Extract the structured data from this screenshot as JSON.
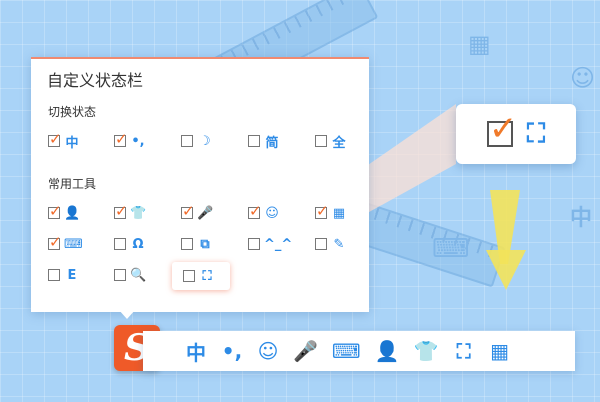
{
  "panel": {
    "title": "自定义状态栏",
    "switch_section": {
      "label": "切换状态",
      "items": [
        {
          "id": "zh",
          "checked": true,
          "icon": "中",
          "icon_name": "chinese-mode-icon"
        },
        {
          "id": "punct",
          "checked": true,
          "icon": "•,",
          "icon_name": "punctuation-icon"
        },
        {
          "id": "halfwidth",
          "checked": false,
          "icon": "☽",
          "icon_name": "moon-halfwidth-icon"
        },
        {
          "id": "simplified",
          "checked": false,
          "icon": "简",
          "icon_name": "simplified-chinese-icon"
        },
        {
          "id": "fullwidth",
          "checked": false,
          "icon": "全",
          "icon_name": "fullwidth-icon"
        }
      ]
    },
    "tools_section": {
      "label": "常用工具",
      "items": [
        {
          "id": "user",
          "checked": true,
          "icon": "👤",
          "icon_name": "user-icon"
        },
        {
          "id": "skin",
          "checked": true,
          "icon": "👕",
          "icon_name": "skin-shirt-icon"
        },
        {
          "id": "voice",
          "checked": true,
          "icon": "🎤",
          "icon_name": "microphone-icon"
        },
        {
          "id": "emoji",
          "checked": true,
          "icon": "☺",
          "icon_name": "emoji-icon"
        },
        {
          "id": "toolbox",
          "checked": true,
          "icon": "▦",
          "icon_name": "toolbox-grid-icon"
        },
        {
          "id": "keyboard",
          "checked": true,
          "icon": "⌨",
          "icon_name": "keyboard-icon"
        },
        {
          "id": "headset",
          "checked": false,
          "icon": "Ω",
          "icon_name": "headset-icon"
        },
        {
          "id": "window",
          "checked": false,
          "icon": "⧉",
          "icon_name": "window-icon"
        },
        {
          "id": "kaomoji",
          "checked": false,
          "icon": "^_^",
          "icon_name": "kaomoji-icon"
        },
        {
          "id": "pen",
          "checked": false,
          "icon": "✎",
          "icon_name": "pen-icon"
        },
        {
          "id": "translate",
          "checked": false,
          "icon": "E",
          "icon_name": "translate-icon"
        },
        {
          "id": "search",
          "checked": false,
          "icon": "🔍",
          "icon_name": "search-icon"
        },
        {
          "id": "crop",
          "checked": false,
          "icon": "⛶",
          "icon_name": "crop-icon"
        }
      ]
    }
  },
  "callout": {
    "checked": true,
    "icon": "⛶",
    "icon_name": "crop-icon"
  },
  "toolbar": {
    "logo": "S",
    "items": [
      {
        "icon": "中",
        "icon_name": "chinese-mode-icon"
      },
      {
        "icon": "•,",
        "icon_name": "punctuation-icon"
      },
      {
        "icon": "☺",
        "icon_name": "emoji-icon"
      },
      {
        "icon": "🎤",
        "icon_name": "microphone-icon"
      },
      {
        "icon": "⌨",
        "icon_name": "keyboard-icon"
      },
      {
        "icon": "👤",
        "icon_name": "user-card-icon"
      },
      {
        "icon": "👕",
        "icon_name": "skin-shirt-icon"
      },
      {
        "icon": "⛶",
        "icon_name": "crop-icon"
      },
      {
        "icon": "▦",
        "icon_name": "toolbox-grid-icon"
      }
    ]
  },
  "colors": {
    "accent": "#2d8be6",
    "check": "#f06a2a",
    "logo": "#ef5a28",
    "background": "#a9d3f7"
  }
}
